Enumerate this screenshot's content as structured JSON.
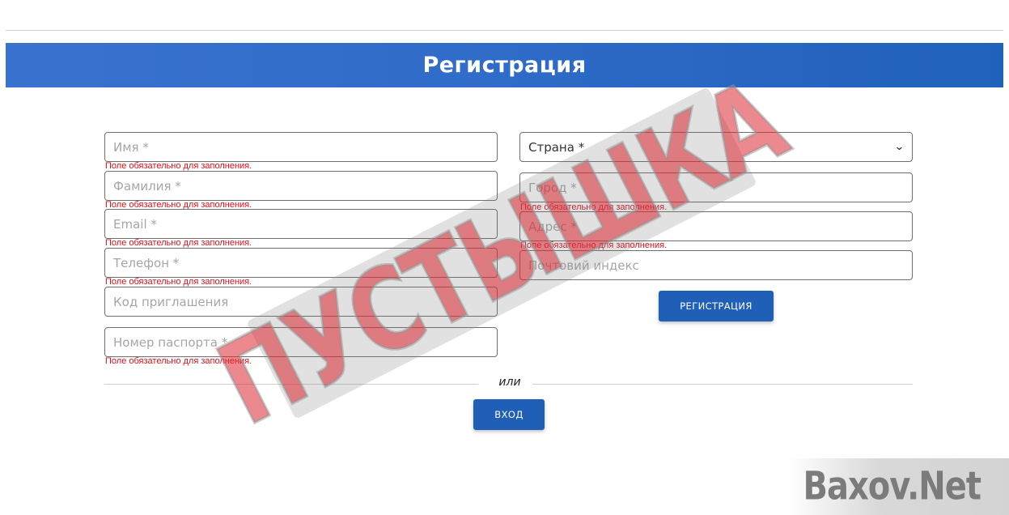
{
  "header": {
    "title": "Регистрация"
  },
  "form": {
    "left": [
      {
        "name": "first-name-field",
        "placeholder": "Имя *",
        "error": "Поле обязательно для заполнения."
      },
      {
        "name": "last-name-field",
        "placeholder": "Фамилия *",
        "error": "Поле обязательно для заполнения."
      },
      {
        "name": "email-field",
        "placeholder": "Email *",
        "error": "Поле обязательно для заполнения."
      },
      {
        "name": "phone-field",
        "placeholder": "Телефон *",
        "error": "Поле обязательно для заполнения."
      },
      {
        "name": "invite-code-field",
        "placeholder": "Код приглашения",
        "error": ""
      },
      {
        "name": "passport-field",
        "placeholder": "Номер паспорта *",
        "error": "Поле обязательно для заполнения."
      }
    ],
    "country": {
      "selected": "Страна *"
    },
    "right": [
      {
        "name": "city-field",
        "placeholder": "Город *",
        "error": "Поле обязательно для заполнения."
      },
      {
        "name": "address-field",
        "placeholder": "Адрес *",
        "error": "Поле обязательно для заполнения."
      },
      {
        "name": "postal-code-field",
        "placeholder": "Почтовий индекс",
        "error": ""
      }
    ],
    "register_label": "РЕГИСТРАЦИЯ",
    "or_label": "или",
    "login_label": "ВХОД"
  },
  "overlay": {
    "stamp_text": "ПУСТЫШКА",
    "watermark": "Baxov.Net"
  },
  "colors": {
    "accent": "#1f5fb8",
    "error": "#e0101a"
  }
}
